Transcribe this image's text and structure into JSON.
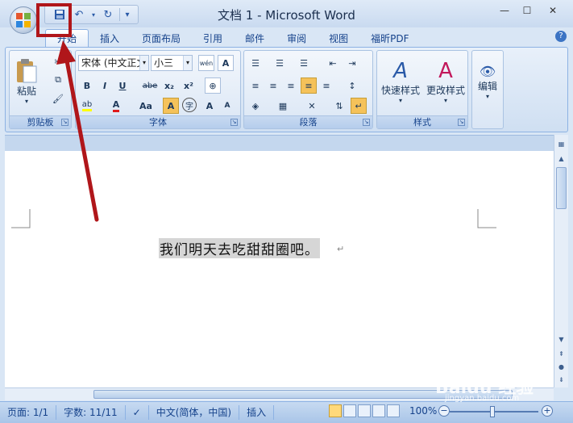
{
  "window": {
    "title": "文档 1 - Microsoft Word",
    "minimize": "—",
    "maximize": "☐",
    "close": "✕"
  },
  "qat": {
    "save_icon": "save-icon",
    "undo_icon": "undo-icon",
    "redo_icon": "redo-icon",
    "customize": "▾"
  },
  "tabs": [
    "开始",
    "插入",
    "页面布局",
    "引用",
    "邮件",
    "审阅",
    "视图",
    "福昕PDF"
  ],
  "help": "?",
  "ribbon": {
    "clipboard": {
      "label": "剪贴板",
      "paste": "粘贴"
    },
    "font": {
      "label": "字体",
      "font_name": "宋体 (中文正文",
      "font_size": "小三",
      "bold": "B",
      "italic": "I",
      "underline": "U",
      "strike": "abe",
      "subscript": "x₂",
      "superscript": "x²",
      "change_case": "Aa",
      "grow": "A",
      "shrink": "A",
      "char_border": "A",
      "enclose": "字",
      "phonetic": "wén"
    },
    "paragraph": {
      "label": "段落"
    },
    "styles": {
      "label": "样式",
      "quick": "快速样式",
      "change": "更改样式"
    },
    "editing": {
      "label": "编辑"
    }
  },
  "document": {
    "text": "我们明天去吃甜甜圈吧。",
    "para_mark": "↵"
  },
  "statusbar": {
    "page": "页面: 1/1",
    "words": "字数: 11/11",
    "language": "中文(简体，中国)",
    "mode": "插入",
    "zoom": "100%"
  },
  "watermark": {
    "brand": "Baidu 经验",
    "url": "jingyan.baidu.com"
  },
  "colors": {
    "highlight": "#b0161a",
    "accent": "#15428b",
    "ribbon": "#dae6f5"
  }
}
